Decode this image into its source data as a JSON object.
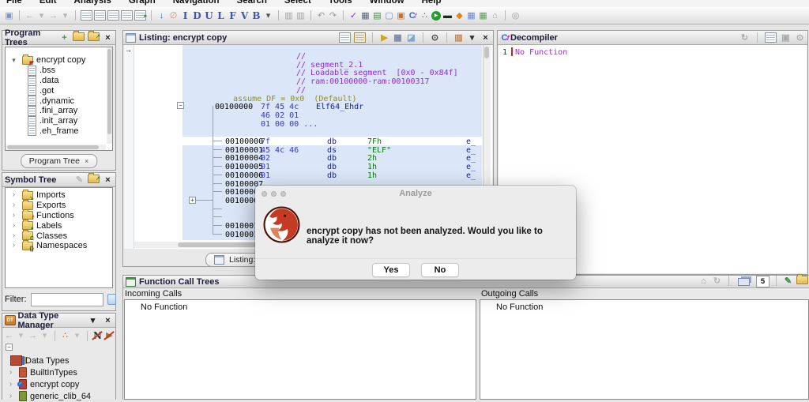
{
  "menu": {
    "items": [
      "File",
      "Edit",
      "Analysis",
      "Graph",
      "Navigation",
      "Search",
      "Select",
      "Tools",
      "Window",
      "Help"
    ]
  },
  "main_toolbar": {
    "icons": [
      {
        "name": "save-icon",
        "glyph": "▣",
        "color": "#7a93c4"
      },
      {
        "sep": true
      },
      {
        "name": "back-icon",
        "glyph": "←",
        "color": "#a6a6a6"
      },
      {
        "name": "back-caret-icon",
        "glyph": "▾",
        "color": "#b5b5b5"
      },
      {
        "name": "forward-icon",
        "glyph": "→",
        "color": "#a6a6a6"
      },
      {
        "name": "forward-caret-icon",
        "glyph": "▾",
        "color": "#b5b5b5"
      },
      {
        "sep": true
      },
      {
        "name": "page-icon-1",
        "cls": "i-page"
      },
      {
        "name": "page-icon-2",
        "cls": "i-page"
      },
      {
        "name": "page-icon-3",
        "cls": "i-page"
      },
      {
        "name": "page-icon-4",
        "cls": "i-page"
      },
      {
        "name": "page-clock-icon",
        "cls": "i-page",
        "badge": "▸",
        "badge_color": "#2a8a2a"
      },
      {
        "sep": true
      },
      {
        "name": "down-arrow-icon",
        "glyph": "↓",
        "color": "#2b5fd9"
      },
      {
        "name": "no-entry-icon",
        "glyph": "∅",
        "color": "#cc8a8a"
      },
      {
        "name": "letter-i-icon",
        "glyph": "I",
        "color": "#3a57b5",
        "cls": "serifL"
      },
      {
        "name": "letter-d-icon",
        "glyph": "D",
        "color": "#3a57b5",
        "cls": "serifL"
      },
      {
        "name": "letter-u-icon",
        "glyph": "U",
        "color": "#3a57b5",
        "cls": "serifL"
      },
      {
        "name": "letter-l-icon",
        "glyph": "L",
        "color": "#3a57b5",
        "cls": "serifL"
      },
      {
        "name": "letter-f-icon",
        "glyph": "F",
        "color": "#3a57b5",
        "cls": "serifL"
      },
      {
        "name": "letter-v-icon",
        "glyph": "V",
        "color": "#3a57b5",
        "cls": "serifL"
      },
      {
        "name": "letter-b-icon",
        "glyph": "B",
        "color": "#3a57b5",
        "cls": "serifL"
      },
      {
        "name": "letters-caret-icon",
        "glyph": "▾",
        "color": "#555"
      },
      {
        "sep": true
      },
      {
        "name": "stamp-in-icon",
        "glyph": "▥",
        "color": "#a0a0a0"
      },
      {
        "name": "stamp-out-icon",
        "glyph": "▥",
        "color": "#a0a0a0"
      },
      {
        "sep": true
      },
      {
        "name": "undo-icon",
        "glyph": "↶",
        "color": "#9a9a9a"
      },
      {
        "name": "redo-icon",
        "glyph": "↷",
        "color": "#9a9a9a"
      },
      {
        "sep": true
      },
      {
        "name": "validate-check-icon",
        "glyph": "✓",
        "color": "#8a2be2"
      },
      {
        "name": "grid-edit-icon",
        "glyph": "▦",
        "color": "#55637a"
      },
      {
        "name": "script-icon",
        "glyph": "▤",
        "color": "#3f8f3f"
      },
      {
        "name": "window-icon",
        "glyph": "▢",
        "color": "#7a8fc0"
      },
      {
        "name": "binary-icon",
        "glyph": "▣",
        "color": "#c07030"
      },
      {
        "name": "code-browser-icon",
        "cls": "i-cf"
      },
      {
        "name": "org-tree-icon",
        "glyph": "∴",
        "color": "#3f8f3f"
      },
      {
        "name": "run-icon",
        "glyph": "▶",
        "cls": "i-run"
      },
      {
        "name": "memory-icon",
        "glyph": "▬",
        "color": "#1a2a1a"
      },
      {
        "name": "diamond-icon",
        "glyph": "◆",
        "color": "#e2831e"
      },
      {
        "name": "table-icon",
        "glyph": "▦",
        "color": "#6f86c9"
      },
      {
        "name": "table-export-icon",
        "glyph": "▦",
        "color": "#56a056"
      },
      {
        "name": "home-org-icon",
        "glyph": "⌂",
        "color": "#a0a0a0"
      },
      {
        "sep": true
      },
      {
        "name": "console-icon",
        "glyph": "◎",
        "color": "#9a9a9a"
      }
    ]
  },
  "program_trees": {
    "title": "Program Trees",
    "header_icons": [
      {
        "name": "new-tree-icon",
        "glyph": "+",
        "color": "#3c9a3c"
      },
      {
        "name": "open-folder-icon",
        "cls": "i-folder"
      },
      {
        "name": "goto-external-icon",
        "cls": "i-folder",
        "badge": "↗",
        "badge_color": "#2a8a2a"
      },
      {
        "name": "close-icon",
        "glyph": "×",
        "color": "#222"
      }
    ],
    "root": "encrypt copy",
    "items": [
      ".bss",
      ".data",
      ".got",
      ".dynamic",
      ".fini_array",
      ".init_array",
      ".eh_frame"
    ],
    "tab_label": "Program Tree",
    "tab_close": "×"
  },
  "symbol_tree": {
    "title": "Symbol Tree",
    "header_icons": [
      {
        "name": "edit-icon",
        "glyph": "✎",
        "color": "#bbb"
      },
      {
        "name": "goto-external-icon",
        "cls": "i-folder",
        "badge": "↗",
        "badge_color": "#2a8a2a"
      },
      {
        "name": "close-icon",
        "glyph": "×",
        "color": "#222"
      }
    ],
    "items": [
      {
        "label": "Imports",
        "badge": "↘",
        "badge_color": "#2a8a2a"
      },
      {
        "label": "Exports",
        "badge": "",
        "badge_color": ""
      },
      {
        "label": "Functions",
        "badge": "f",
        "badge_color": "#cc2222"
      },
      {
        "label": "Labels",
        "badge": "●",
        "badge_color": "#2a8a2a"
      },
      {
        "label": "Classes",
        "badge": "C",
        "badge_color": "#1a7a1a"
      },
      {
        "label": "Namespaces",
        "badge": "{}",
        "badge_color": "#333"
      }
    ],
    "filter_label": "Filter:",
    "filter_value": ""
  },
  "data_type_manager": {
    "title": "Data Type Manager",
    "header_icons": [
      {
        "name": "menu-caret-icon",
        "glyph": "▾",
        "color": "#222"
      },
      {
        "name": "close-icon",
        "glyph": "×",
        "color": "#222"
      }
    ],
    "toolbar_icons": [
      {
        "name": "back-icon",
        "glyph": "←",
        "color": "#aaa"
      },
      {
        "name": "back-caret-icon",
        "glyph": "▾",
        "color": "#bbb"
      },
      {
        "name": "forward-icon",
        "glyph": "→",
        "color": "#aaa"
      },
      {
        "name": "forward-caret-icon",
        "glyph": "▾",
        "color": "#bbb"
      },
      {
        "sep": true
      },
      {
        "name": "conflict-mode-icon",
        "glyph": "∴",
        "color": "#b35a2a"
      },
      {
        "name": "conflict-caret-icon",
        "glyph": "▾",
        "color": "#bbb"
      },
      {
        "sep": true
      },
      {
        "name": "hide-names-icon",
        "glyph": "N",
        "color": "#333",
        "cls": "i-slash serifL"
      },
      {
        "name": "pointer-filter-icon",
        "glyph": "▶",
        "color": "#99772a",
        "cls": "i-slash"
      }
    ],
    "root": "Data Types",
    "items": [
      {
        "label": "BuiltInTypes",
        "color": "#c2573a",
        "checked": false
      },
      {
        "label": "encrypt copy",
        "color": "#c23a2e",
        "checked": true
      },
      {
        "label": "generic_clib_64",
        "color": "#7a9a3a",
        "checked": false
      }
    ]
  },
  "listing": {
    "title": "Listing:  encrypt copy",
    "header_icons": [
      {
        "name": "copy-icon",
        "cls": "i-page"
      },
      {
        "name": "paste-icon",
        "cls": "i-page i-page-gold"
      },
      {
        "sep": true
      },
      {
        "name": "cursor-style-icon",
        "glyph": "▶",
        "color": "#caa62a"
      },
      {
        "name": "edit-fields-icon",
        "glyph": "▦",
        "color": "#7788aa"
      },
      {
        "name": "diff-icon",
        "glyph": "◪",
        "color": "#7aa8c8"
      },
      {
        "sep": true
      },
      {
        "name": "snapshot-icon",
        "glyph": "⊙",
        "color": "#444"
      },
      {
        "sep": true
      },
      {
        "name": "margin-icon",
        "glyph": "▥",
        "color": "#b9885a"
      },
      {
        "name": "margin-caret-icon",
        "glyph": "▾",
        "color": "#333"
      },
      {
        "name": "close-icon",
        "glyph": "×",
        "color": "#222"
      }
    ],
    "plate_comments": [
      "//",
      "// segment_2.1",
      "// Loadable segment  [0x0 - 0x84f]",
      "// ram:00100000-ram:00100317",
      "//"
    ],
    "assume_line": "assume DF = 0x0  (Default)",
    "ehdr": {
      "address": "00100000",
      "bytes_lines": [
        "7f 45 4c",
        "46 02 01",
        "01 00 00 ..."
      ],
      "label": "Elf64_Ehdr"
    },
    "rows": [
      {
        "address": "00100000",
        "bytes": "7f",
        "mnemonic": "db",
        "operand": "7Fh",
        "field": "e_",
        "current": true
      },
      {
        "address": "00100001",
        "bytes": "45 4c 46",
        "mnemonic": "ds",
        "operand": "\"ELF\"",
        "field": "e_"
      },
      {
        "address": "00100004",
        "bytes": "02",
        "mnemonic": "db",
        "operand": "2h",
        "field": "e_"
      },
      {
        "address": "00100005",
        "bytes": "01",
        "mnemonic": "db",
        "operand": "1h",
        "field": "e_"
      },
      {
        "address": "00100006",
        "bytes": "01",
        "mnemonic": "db",
        "operand": "1h",
        "field": "e_"
      },
      {
        "address": "00100007"
      },
      {
        "address": "00100008"
      },
      {
        "address": "00100009",
        "expand": true
      },
      {
        "address": ""
      },
      {
        "address": ""
      },
      {
        "address": "00100010"
      },
      {
        "address": "00100012"
      }
    ],
    "tab_label": "Listing:  e"
  },
  "decompiler": {
    "title": "Decompiler",
    "header_icons": [
      {
        "name": "refresh-icon",
        "glyph": "↻",
        "color": "#aaa"
      },
      {
        "sep": true
      },
      {
        "name": "copy-icon",
        "cls": "i-page"
      },
      {
        "name": "export-icon",
        "glyph": "▣",
        "color": "#aaa"
      },
      {
        "name": "snapshot-icon",
        "glyph": "⊙",
        "color": "#aaa"
      }
    ],
    "line_number": "1",
    "content": "No Function"
  },
  "function_call_trees": {
    "title": "Function Call Trees",
    "header_icons": [
      {
        "name": "home-icon",
        "glyph": "⌂",
        "color": "#999"
      },
      {
        "name": "refresh-icon",
        "glyph": "↻",
        "color": "#b5b5b5"
      },
      {
        "sep": true
      },
      {
        "name": "layers-icon",
        "cls": "i-layers"
      },
      {
        "name": "depth-spinner",
        "boxed": "5"
      },
      {
        "sep": true
      },
      {
        "name": "edit-icon",
        "glyph": "✎",
        "color": "#3a8a3a"
      },
      {
        "name": "goto-external-icon",
        "cls": "i-folder"
      }
    ],
    "incoming_label": "Incoming Calls",
    "outgoing_label": "Outgoing Calls",
    "incoming_value": "No Function",
    "outgoing_value": "No Function"
  },
  "dialog": {
    "title": "Analyze",
    "message": "encrypt copy has not been analyzed. Would you like to analyze it now?",
    "yes_label": "Yes",
    "no_label": "No"
  },
  "colors": {
    "selection_blue": "#dbe7f8",
    "comment_purple": "#8a2fc9",
    "assume_olive": "#8f8c2a",
    "bytes_blue": "#3434cf",
    "mnemonic_navy": "#121d9c",
    "operand_green": "#0a7a0a",
    "address_black": "#000000",
    "decompiler_purple": "#a228e8",
    "caret_red": "#cc2222"
  }
}
